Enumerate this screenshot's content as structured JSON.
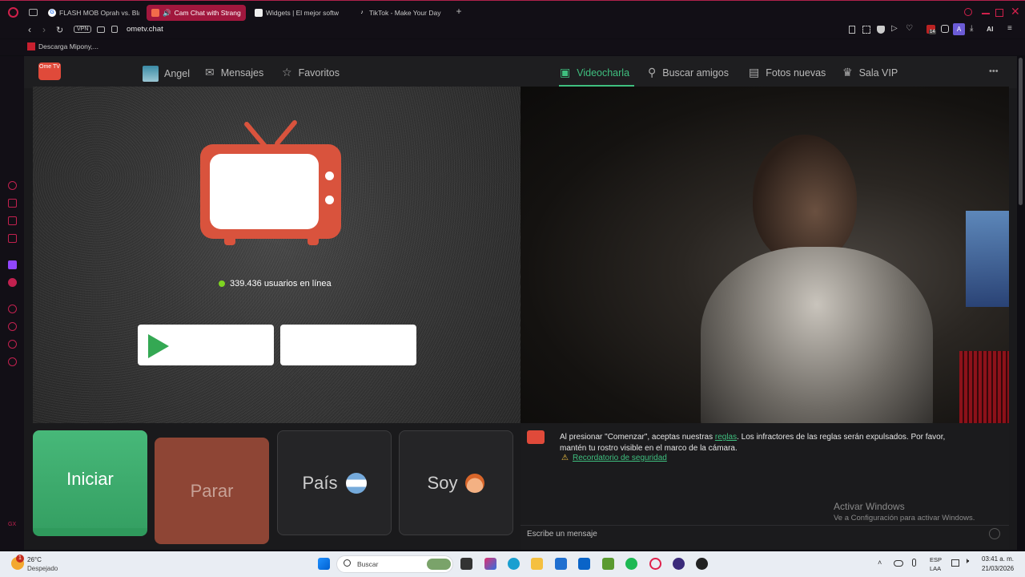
{
  "browser": {
    "tabs": [
      {
        "label": "FLASH MOB Oprah vs. Bla",
        "active": false
      },
      {
        "label": "Cam Chat with Strang",
        "active": true
      },
      {
        "label": "Widgets | El mejor softw",
        "active": false
      },
      {
        "label": "TikTok - Make Your Day",
        "active": false
      }
    ],
    "new_tab": "+",
    "url": "ometv.chat",
    "vpn_label": "VPN",
    "ai_label": "AI",
    "profile_initial": "A",
    "badge_count": "14",
    "bookmark": "Descarga Mipony,...",
    "sidebar_bottom": "GX"
  },
  "site": {
    "logo_text": "Ome TV",
    "nav_left": [
      {
        "label": "Angel",
        "icon": "avatar-icon"
      },
      {
        "label": "Mensajes",
        "icon": "mail-icon"
      },
      {
        "label": "Favoritos",
        "icon": "star-icon"
      }
    ],
    "nav_right": [
      {
        "label": "Videocharla",
        "icon": "video-icon",
        "active": true
      },
      {
        "label": "Buscar amigos",
        "icon": "search-icon"
      },
      {
        "label": "Fotos nuevas",
        "icon": "photos-icon"
      },
      {
        "label": "Sala VIP",
        "icon": "vip-icon"
      }
    ],
    "more": "•••",
    "online_text": "339.436 usuarios en línea",
    "buttons": {
      "start": "Iniciar",
      "stop": "Parar",
      "country": "País",
      "gender": "Soy"
    },
    "notice": {
      "text_before": "Al presionar \"Comenzar\", aceptas nuestras ",
      "link": "reglas",
      "text_after": ". Los infractores de las reglas serán expulsados. Por favor, mantén tu rostro visible en el marco de la cámara.",
      "safety_link": "Recordatorio de seguridad"
    },
    "watermark_title": "Activar Windows",
    "watermark_sub": "Ve a Configuración para activar Windows.",
    "message_placeholder": "Escribe un mensaje"
  },
  "taskbar": {
    "weather_temp": "26°C",
    "weather_desc": "Despejado",
    "search_placeholder": "Buscar",
    "lang_top": "ESP",
    "lang_bottom": "LAA",
    "time": "03:41 a. m.",
    "date": "21/03/2026",
    "notif_count": "1"
  },
  "colors": {
    "accent_red": "#a1173d",
    "green_start": "#3fae6e",
    "red_stop": "#8e4535",
    "tv_red": "#d9533d"
  }
}
